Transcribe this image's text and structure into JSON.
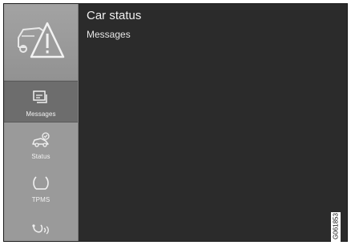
{
  "header": {
    "title": "Car status",
    "subtitle": "Messages"
  },
  "sidebar": {
    "app_icon": "car-warning-icon",
    "items": [
      {
        "label": "Messages",
        "icon": "messages-icon",
        "active": true
      },
      {
        "label": "Status",
        "icon": "car-status-icon",
        "active": false
      },
      {
        "label": "TPMS",
        "icon": "tire-pressure-icon",
        "active": false
      },
      {
        "label": "",
        "icon": "service-icon",
        "active": false
      }
    ]
  },
  "figure_code": "G061853",
  "colors": {
    "sidebar_bg": "#9a9a9a",
    "sidebar_active": "#6d6d6d",
    "main_bg": "#2b2b2b",
    "text": "#f0f0f0"
  }
}
